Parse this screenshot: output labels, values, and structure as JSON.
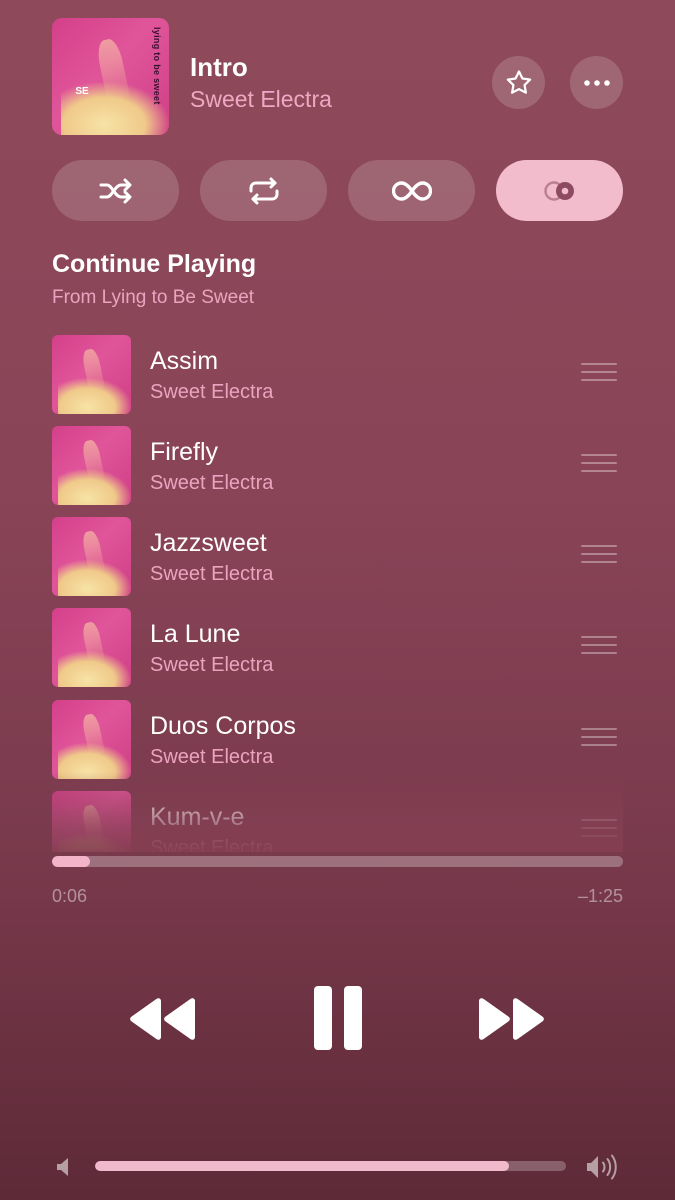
{
  "now_playing": {
    "title": "Intro",
    "artist": "Sweet Electra",
    "album_cover_text": "lying to be sweet",
    "album_cover_logo": "SE"
  },
  "header_actions": {
    "favorite_icon": "star-icon",
    "more_icon": "ellipsis-icon"
  },
  "modes": [
    {
      "icon": "shuffle-icon",
      "active": false
    },
    {
      "icon": "repeat-icon",
      "active": false
    },
    {
      "icon": "infinity-icon",
      "active": false
    },
    {
      "icon": "crossfade-icon",
      "active": true
    }
  ],
  "queue": {
    "title": "Continue Playing",
    "subtitle": "From Lying to Be Sweet",
    "items": [
      {
        "title": "Assim",
        "artist": "Sweet Electra"
      },
      {
        "title": "Firefly",
        "artist": "Sweet Electra"
      },
      {
        "title": "Jazzsweet",
        "artist": "Sweet Electra"
      },
      {
        "title": "La Lune",
        "artist": "Sweet Electra"
      },
      {
        "title": "Duos Corpos",
        "artist": "Sweet Electra"
      },
      {
        "title": "Kum-v-e",
        "artist": "Sweet Electra"
      }
    ]
  },
  "playback": {
    "elapsed": "0:06",
    "remaining": "–1:25",
    "progress_fraction": 0.067
  },
  "transport": {
    "previous_icon": "rewind-icon",
    "pause_icon": "pause-icon",
    "next_icon": "fast-forward-icon"
  },
  "volume": {
    "level_fraction": 0.88,
    "low_icon": "speaker-low-icon",
    "high_icon": "speaker-high-icon"
  },
  "colors": {
    "accent_pink": "#f3bccd",
    "subtitle_pink": "#eba3bf",
    "background": "#8a4458"
  }
}
